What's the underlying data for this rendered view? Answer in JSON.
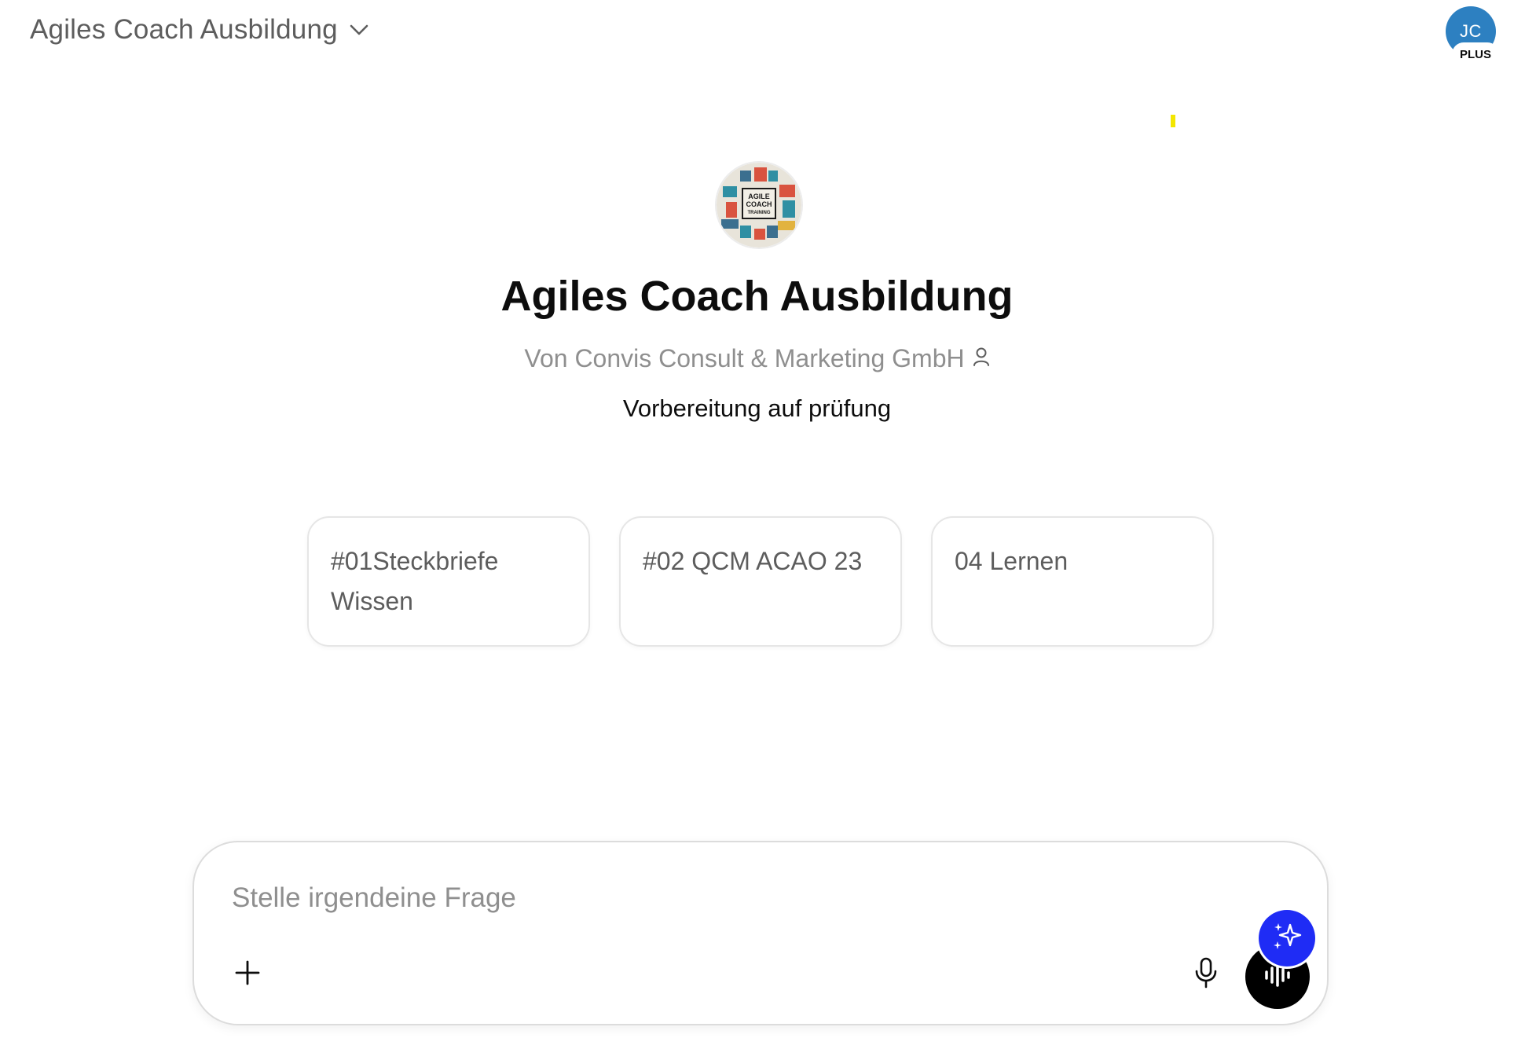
{
  "header": {
    "model_title": "Agiles Coach Ausbildung",
    "chevron_icon": "chevron-down-icon",
    "avatar_initials": "JC",
    "avatar_color": "#2d80c1",
    "plan_badge": "PLUS"
  },
  "gpt": {
    "logo_text": "AGILE COACH TRAINING",
    "title": "Agiles Coach Ausbildung",
    "author": "Von Convis Consult & Marketing GmbH",
    "author_icon": "person-icon",
    "description": "Vorbereitung auf prüfung"
  },
  "starters": [
    {
      "label": "#01Steckbriefe Wissen"
    },
    {
      "label": "#02 QCM ACAO 23"
    },
    {
      "label": "04 Lernen"
    }
  ],
  "composer": {
    "placeholder": "Stelle irgendeine Frage",
    "value": "",
    "attach_icon": "plus-icon",
    "mic_icon": "microphone-icon",
    "voice_icon": "voice-waveform-icon",
    "assistant_icon": "sparkle-icon",
    "assistant_color": "#1f2cf5"
  }
}
